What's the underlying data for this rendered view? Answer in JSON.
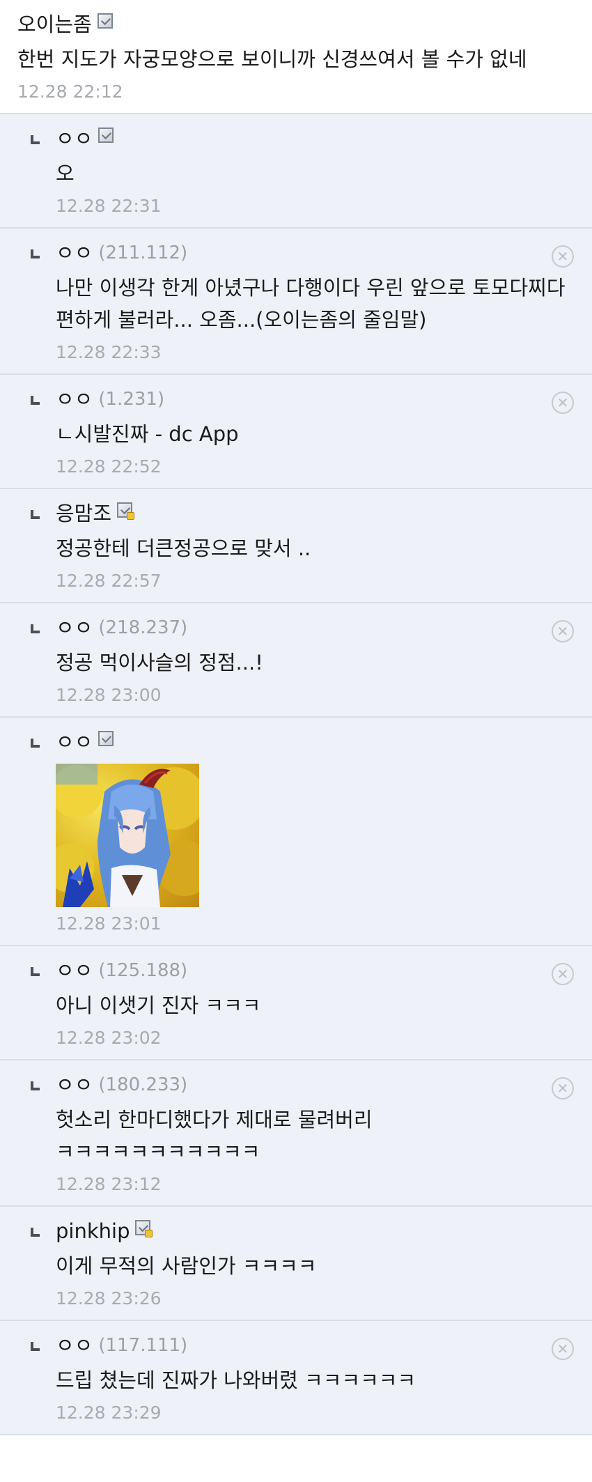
{
  "post": {
    "nick": "오이는좀",
    "text": "한번 지도가 자궁모양으로 보이니까 신경쓰여서 볼 수가 없네",
    "time": "12.28 22:12"
  },
  "replies": [
    {
      "nick": "ㅇㅇ",
      "ip": "",
      "badge": "gallog",
      "text": "오",
      "time": "12.28 22:31",
      "deletable": false
    },
    {
      "nick": "ㅇㅇ",
      "ip": "(211.112)",
      "badge": "",
      "text": "나만 이생각 한게 아녔구나 다행이다 우린 앞으로 토모다찌다 편하게 불러라... 오좀...(오이는좀의 줄임말)",
      "time": "12.28 22:33",
      "deletable": true
    },
    {
      "nick": "ㅇㅇ",
      "ip": "(1.231)",
      "badge": "",
      "text": "ㄴ시발진짜 - dc App",
      "time": "12.28 22:52",
      "deletable": true
    },
    {
      "nick": "응맘조",
      "ip": "",
      "badge": "gallog-fixed",
      "text": "정공한테 더큰정공으로 맞서 ..",
      "time": "12.28 22:57",
      "deletable": false
    },
    {
      "nick": "ㅇㅇ",
      "ip": "(218.237)",
      "badge": "",
      "text": "정공 먹이사슬의 정점...!",
      "time": "12.28 23:00",
      "deletable": true
    },
    {
      "nick": "ㅇㅇ",
      "ip": "",
      "badge": "gallog",
      "text": "",
      "image": "anime-character-thumbnail",
      "time": "12.28 23:01",
      "deletable": false
    },
    {
      "nick": "ㅇㅇ",
      "ip": "(125.188)",
      "badge": "",
      "text": "아니 이샛기 진자 ㅋㅋㅋ",
      "time": "12.28 23:02",
      "deletable": true
    },
    {
      "nick": "ㅇㅇ",
      "ip": "(180.233)",
      "badge": "",
      "text": "헛소리 한마디했다가 제대로 물려버리 ㅋㅋㅋㅋㅋㅋㅋㅋㅋㅋㅋ",
      "time": "12.28 23:12",
      "deletable": true
    },
    {
      "nick": "pinkhip",
      "ip": "",
      "badge": "gallog-fixed",
      "text": "이게 무적의 사람인가 ㅋㅋㅋㅋ",
      "time": "12.28 23:26",
      "deletable": false
    },
    {
      "nick": "ㅇㅇ",
      "ip": "(117.111)",
      "badge": "",
      "text": "드립 쳤는데 진짜가 나와버렸 ㅋㅋㅋㅋㅋㅋ",
      "time": "12.28 23:29",
      "deletable": true
    }
  ],
  "icons": {
    "reply": "reply-arrow-icon",
    "delete": "delete-circle-x-icon",
    "badge": "gallog-badge-icon"
  },
  "colors": {
    "reply_bg": "#eef2f8",
    "divider": "#d6dee8",
    "meta_text": "#a6aab2"
  }
}
